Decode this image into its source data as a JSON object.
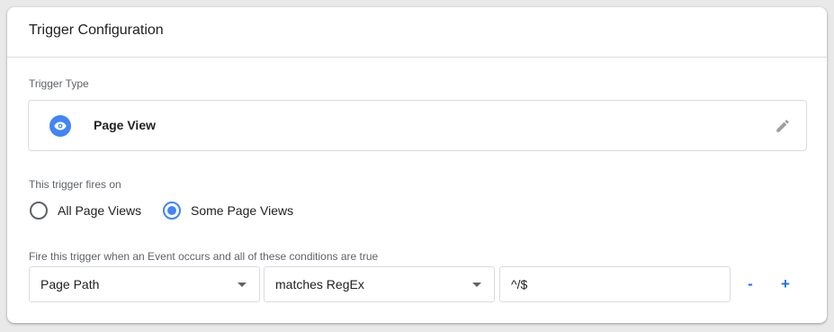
{
  "card": {
    "title": "Trigger Configuration"
  },
  "trigger_type": {
    "label": "Trigger Type",
    "name": "Page View",
    "icon": "eye-icon",
    "edit_icon": "pencil-icon",
    "accent": "#4285f4"
  },
  "fires_on": {
    "label": "This trigger fires on",
    "options": [
      {
        "label": "All Page Views",
        "checked": false
      },
      {
        "label": "Some Page Views",
        "checked": true
      }
    ]
  },
  "conditions": {
    "label": "Fire this trigger when an Event occurs and all of these conditions are true",
    "rows": [
      {
        "variable": "Page Path",
        "operator": "matches RegEx",
        "value": "^/$"
      }
    ],
    "remove_label": "-",
    "add_label": "+"
  }
}
